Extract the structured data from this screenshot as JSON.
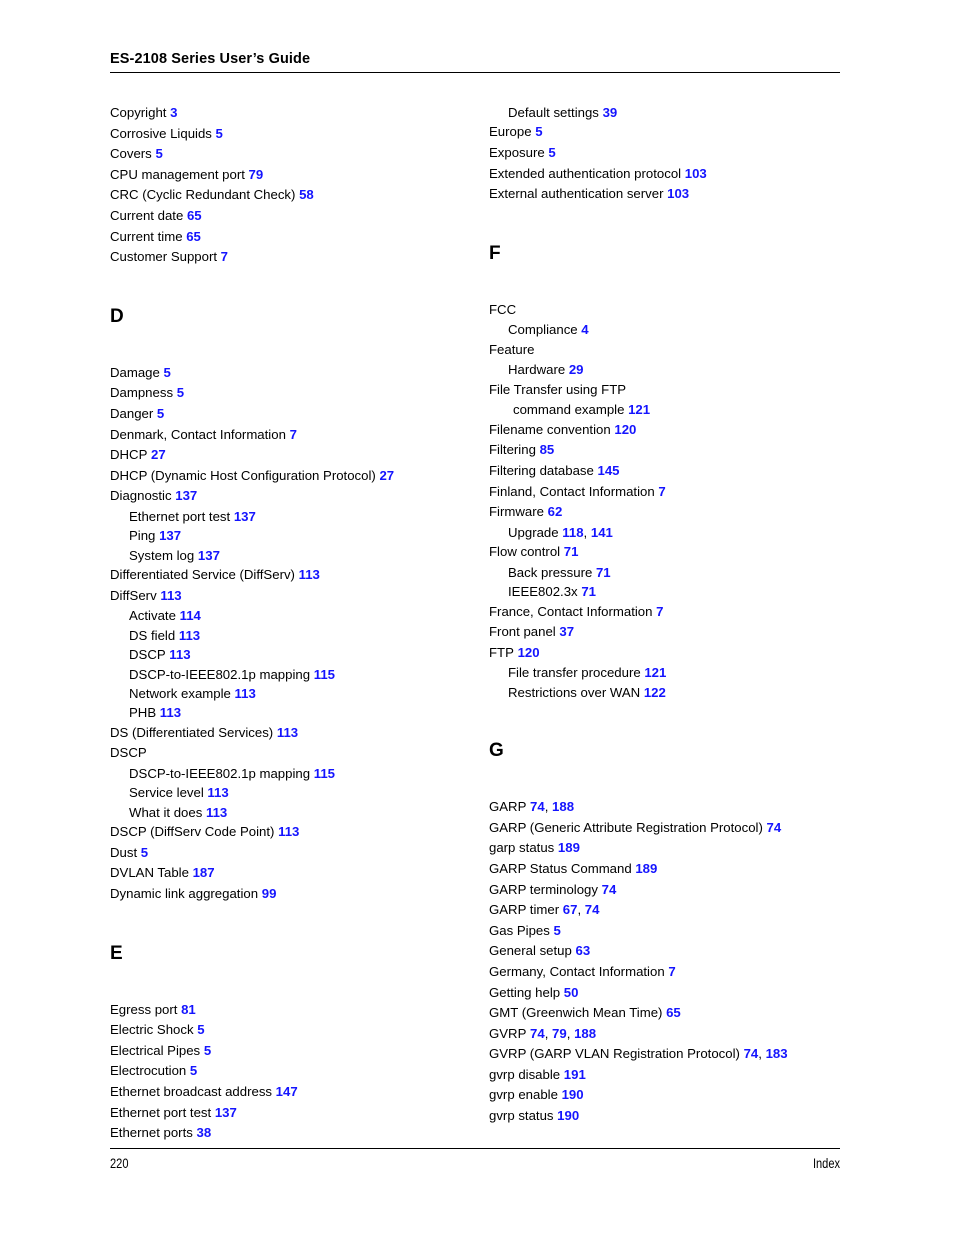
{
  "header": {
    "title": "ES-2108 Series User’s Guide"
  },
  "footer": {
    "page_number": "220",
    "label": "Index"
  },
  "colors": {
    "page_number_link": "#1414ff",
    "text": "#000000"
  },
  "columns": {
    "left": [
      {
        "kind": "entry",
        "level": 0,
        "text": "Copyright",
        "pages": [
          "3"
        ]
      },
      {
        "kind": "entry",
        "level": 0,
        "text": "Corrosive Liquids",
        "pages": [
          "5"
        ]
      },
      {
        "kind": "entry",
        "level": 0,
        "text": "Covers",
        "pages": [
          "5"
        ]
      },
      {
        "kind": "entry",
        "level": 0,
        "text": "CPU management port",
        "pages": [
          "79"
        ]
      },
      {
        "kind": "entry",
        "level": 0,
        "text": "CRC (Cyclic Redundant Check)",
        "pages": [
          "58"
        ]
      },
      {
        "kind": "entry",
        "level": 0,
        "text": "Current date",
        "pages": [
          "65"
        ]
      },
      {
        "kind": "entry",
        "level": 0,
        "text": "Current time",
        "pages": [
          "65"
        ]
      },
      {
        "kind": "entry",
        "level": 0,
        "text": "Customer Support",
        "pages": [
          "7"
        ]
      },
      {
        "kind": "letter",
        "text": "D"
      },
      {
        "kind": "entry",
        "level": 0,
        "text": "Damage",
        "pages": [
          "5"
        ]
      },
      {
        "kind": "entry",
        "level": 0,
        "text": "Dampness",
        "pages": [
          "5"
        ]
      },
      {
        "kind": "entry",
        "level": 0,
        "text": "Danger",
        "pages": [
          "5"
        ]
      },
      {
        "kind": "entry",
        "level": 0,
        "text": "Denmark, Contact Information",
        "pages": [
          "7"
        ]
      },
      {
        "kind": "entry",
        "level": 0,
        "text": "DHCP",
        "pages": [
          "27"
        ]
      },
      {
        "kind": "entry",
        "level": 0,
        "text": "DHCP (Dynamic Host Configuration Protocol)",
        "pages": [
          "27"
        ]
      },
      {
        "kind": "entry",
        "level": 0,
        "text": "Diagnostic",
        "pages": [
          "137"
        ]
      },
      {
        "kind": "entry",
        "level": 1,
        "text": "Ethernet port test",
        "pages": [
          "137"
        ]
      },
      {
        "kind": "entry",
        "level": 1,
        "text": "Ping",
        "pages": [
          "137"
        ]
      },
      {
        "kind": "entry",
        "level": 1,
        "text": "System log",
        "pages": [
          "137"
        ]
      },
      {
        "kind": "entry",
        "level": 0,
        "text": "Differentiated Service (DiffServ)",
        "pages": [
          "113"
        ]
      },
      {
        "kind": "entry",
        "level": 0,
        "text": "DiffServ",
        "pages": [
          "113"
        ]
      },
      {
        "kind": "entry",
        "level": 1,
        "text": "Activate",
        "pages": [
          "114"
        ]
      },
      {
        "kind": "entry",
        "level": 1,
        "text": "DS field",
        "pages": [
          "113"
        ]
      },
      {
        "kind": "entry",
        "level": 1,
        "text": "DSCP",
        "pages": [
          "113"
        ]
      },
      {
        "kind": "entry",
        "level": 1,
        "text": "DSCP-to-IEEE802.1p mapping",
        "pages": [
          "115"
        ]
      },
      {
        "kind": "entry",
        "level": 1,
        "text": "Network example",
        "pages": [
          "113"
        ]
      },
      {
        "kind": "entry",
        "level": 1,
        "text": "PHB",
        "pages": [
          "113"
        ]
      },
      {
        "kind": "entry",
        "level": 0,
        "text": "DS (Differentiated Services)",
        "pages": [
          "113"
        ]
      },
      {
        "kind": "entry",
        "level": 0,
        "text": "DSCP",
        "pages": []
      },
      {
        "kind": "entry",
        "level": 1,
        "text": "DSCP-to-IEEE802.1p mapping",
        "pages": [
          "115"
        ]
      },
      {
        "kind": "entry",
        "level": 1,
        "text": "Service level",
        "pages": [
          "113"
        ]
      },
      {
        "kind": "entry",
        "level": 1,
        "text": "What it does",
        "pages": [
          "113"
        ]
      },
      {
        "kind": "entry",
        "level": 0,
        "text": "DSCP (DiffServ Code Point)",
        "pages": [
          "113"
        ]
      },
      {
        "kind": "entry",
        "level": 0,
        "text": "Dust",
        "pages": [
          "5"
        ]
      },
      {
        "kind": "entry",
        "level": 0,
        "text": "DVLAN Table",
        "pages": [
          "187"
        ]
      },
      {
        "kind": "entry",
        "level": 0,
        "text": "Dynamic link aggregation",
        "pages": [
          "99"
        ]
      },
      {
        "kind": "letter",
        "text": "E"
      },
      {
        "kind": "entry",
        "level": 0,
        "text": "Egress port",
        "pages": [
          "81"
        ]
      },
      {
        "kind": "entry",
        "level": 0,
        "text": "Electric Shock",
        "pages": [
          "5"
        ]
      },
      {
        "kind": "entry",
        "level": 0,
        "text": "Electrical Pipes",
        "pages": [
          "5"
        ]
      },
      {
        "kind": "entry",
        "level": 0,
        "text": "Electrocution",
        "pages": [
          "5"
        ]
      },
      {
        "kind": "entry",
        "level": 0,
        "text": "Ethernet broadcast address",
        "pages": [
          "147"
        ]
      },
      {
        "kind": "entry",
        "level": 0,
        "text": "Ethernet port test",
        "pages": [
          "137"
        ]
      },
      {
        "kind": "entry",
        "level": 0,
        "text": "Ethernet ports",
        "pages": [
          "38"
        ]
      }
    ],
    "right": [
      {
        "kind": "entry",
        "level": 1,
        "text": "Default settings",
        "pages": [
          "39"
        ]
      },
      {
        "kind": "entry",
        "level": 0,
        "text": "Europe",
        "pages": [
          "5"
        ]
      },
      {
        "kind": "entry",
        "level": 0,
        "text": "Exposure",
        "pages": [
          "5"
        ]
      },
      {
        "kind": "entry",
        "level": 0,
        "text": "Extended authentication protocol",
        "pages": [
          "103"
        ]
      },
      {
        "kind": "entry",
        "level": 0,
        "text": "External authentication server",
        "pages": [
          "103"
        ]
      },
      {
        "kind": "letter",
        "text": "F"
      },
      {
        "kind": "entry",
        "level": 0,
        "text": "FCC",
        "pages": []
      },
      {
        "kind": "entry",
        "level": 1,
        "text": "Compliance",
        "pages": [
          "4"
        ]
      },
      {
        "kind": "entry",
        "level": 0,
        "text": "Feature",
        "pages": []
      },
      {
        "kind": "entry",
        "level": 1,
        "text": "Hardware",
        "pages": [
          "29"
        ]
      },
      {
        "kind": "entry",
        "level": 0,
        "text": "File Transfer using FTP",
        "pages": []
      },
      {
        "kind": "entry",
        "level": 2,
        "text": "command example",
        "pages": [
          "121"
        ]
      },
      {
        "kind": "entry",
        "level": 0,
        "text": "Filename convention",
        "pages": [
          "120"
        ]
      },
      {
        "kind": "entry",
        "level": 0,
        "text": "Filtering",
        "pages": [
          "85"
        ]
      },
      {
        "kind": "entry",
        "level": 0,
        "text": "Filtering database",
        "pages": [
          "145"
        ]
      },
      {
        "kind": "entry",
        "level": 0,
        "text": "Finland, Contact Information",
        "pages": [
          "7"
        ]
      },
      {
        "kind": "entry",
        "level": 0,
        "text": "Firmware",
        "pages": [
          "62"
        ]
      },
      {
        "kind": "entry",
        "level": 1,
        "text": "Upgrade",
        "pages": [
          "118",
          "141"
        ]
      },
      {
        "kind": "entry",
        "level": 0,
        "text": "Flow control",
        "pages": [
          "71"
        ]
      },
      {
        "kind": "entry",
        "level": 1,
        "text": "Back pressure",
        "pages": [
          "71"
        ]
      },
      {
        "kind": "entry",
        "level": 1,
        "text": "IEEE802.3x",
        "pages": [
          "71"
        ]
      },
      {
        "kind": "entry",
        "level": 0,
        "text": "France, Contact Information",
        "pages": [
          "7"
        ]
      },
      {
        "kind": "entry",
        "level": 0,
        "text": "Front panel",
        "pages": [
          "37"
        ]
      },
      {
        "kind": "entry",
        "level": 0,
        "text": "FTP",
        "pages": [
          "120"
        ]
      },
      {
        "kind": "entry",
        "level": 1,
        "text": "File transfer procedure",
        "pages": [
          "121"
        ]
      },
      {
        "kind": "entry",
        "level": 1,
        "text": "Restrictions over WAN",
        "pages": [
          "122"
        ]
      },
      {
        "kind": "letter",
        "text": "G"
      },
      {
        "kind": "entry",
        "level": 0,
        "text": "GARP",
        "pages": [
          "74",
          "188"
        ]
      },
      {
        "kind": "entry",
        "level": 0,
        "text": "GARP (Generic Attribute Registration Protocol)",
        "pages": [
          "74"
        ]
      },
      {
        "kind": "entry",
        "level": 0,
        "text": "garp status",
        "pages": [
          "189"
        ]
      },
      {
        "kind": "entry",
        "level": 0,
        "text": "GARP Status Command",
        "pages": [
          "189"
        ]
      },
      {
        "kind": "entry",
        "level": 0,
        "text": "GARP terminology",
        "pages": [
          "74"
        ]
      },
      {
        "kind": "entry",
        "level": 0,
        "text": "GARP timer",
        "pages": [
          "67",
          "74"
        ]
      },
      {
        "kind": "entry",
        "level": 0,
        "text": "Gas Pipes",
        "pages": [
          "5"
        ]
      },
      {
        "kind": "entry",
        "level": 0,
        "text": "General setup",
        "pages": [
          "63"
        ]
      },
      {
        "kind": "entry",
        "level": 0,
        "text": "Germany, Contact Information",
        "pages": [
          "7"
        ]
      },
      {
        "kind": "entry",
        "level": 0,
        "text": "Getting help",
        "pages": [
          "50"
        ]
      },
      {
        "kind": "entry",
        "level": 0,
        "text": "GMT (Greenwich Mean Time)",
        "pages": [
          "65"
        ]
      },
      {
        "kind": "entry",
        "level": 0,
        "text": "GVRP",
        "pages": [
          "74",
          "79",
          "188"
        ]
      },
      {
        "kind": "entry",
        "level": 0,
        "text": "GVRP (GARP VLAN Registration Protocol)",
        "pages": [
          "74",
          "183"
        ]
      },
      {
        "kind": "entry",
        "level": 0,
        "text": "gvrp disable",
        "pages": [
          "191"
        ]
      },
      {
        "kind": "entry",
        "level": 0,
        "text": "gvrp enable",
        "pages": [
          "190"
        ]
      },
      {
        "kind": "entry",
        "level": 0,
        "text": "gvrp status",
        "pages": [
          "190"
        ]
      }
    ]
  }
}
